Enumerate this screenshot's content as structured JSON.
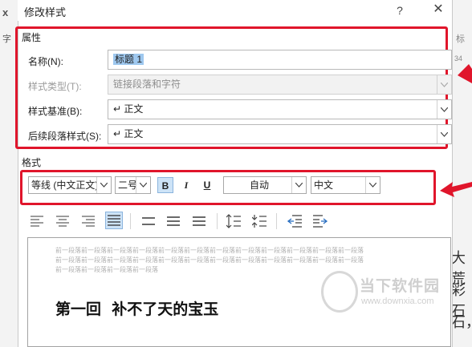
{
  "dialog": {
    "title": "修改样式",
    "help_label": "?",
    "close_label": "✕"
  },
  "properties": {
    "section_label": "属性",
    "name_label": "名称(N):",
    "name_value": "标题 1",
    "type_label": "样式类型(T):",
    "type_value": "链接段落和字符",
    "based_label": "样式基准(B):",
    "based_value": "↵ 正文",
    "next_label": "后续段落样式(S):",
    "next_value": "↵ 正文"
  },
  "format": {
    "section_label": "格式",
    "font_value": "等线 (中文正文)",
    "size_value": "二号",
    "bold_label": "B",
    "italic_label": "I",
    "underline_label": "U",
    "color_value": "自动",
    "lang_value": "中文"
  },
  "preview": {
    "prev_lines": [
      "前一段落前一段落前一段落前一段落前一段落前一段落前一段落前一段落前一段落前一段落前一段落前一段落",
      "前一段落前一段落前一段落前一段落前一段落前一段落前一段落前一段落前一段落前一段落前一段落前一段落",
      "前一段落前一段落前一段落前一段落"
    ],
    "heading": "第一回  补不了天的宝玉"
  },
  "background": {
    "left_top": "x",
    "left_word": "字",
    "right_fragments": [
      "标",
      "34",
      "大荒",
      "彩石",
      "石，"
    ]
  },
  "watermark": {
    "name": "当下软件园",
    "url": "www.downxia.com"
  },
  "colors": {
    "highlight_red": "#e0152b",
    "selection": "#9ec8ef",
    "active_button": "#cde3f7"
  },
  "icons": [
    "question-icon",
    "close-icon",
    "dropdown-arrow-icon",
    "align-left-icon",
    "align-center-icon",
    "align-right-icon",
    "align-justify-icon",
    "line-spacing-icon",
    "paragraph-spacing-icon",
    "indent-decrease-icon",
    "indent-increase-icon",
    "red-arrow-icon"
  ]
}
